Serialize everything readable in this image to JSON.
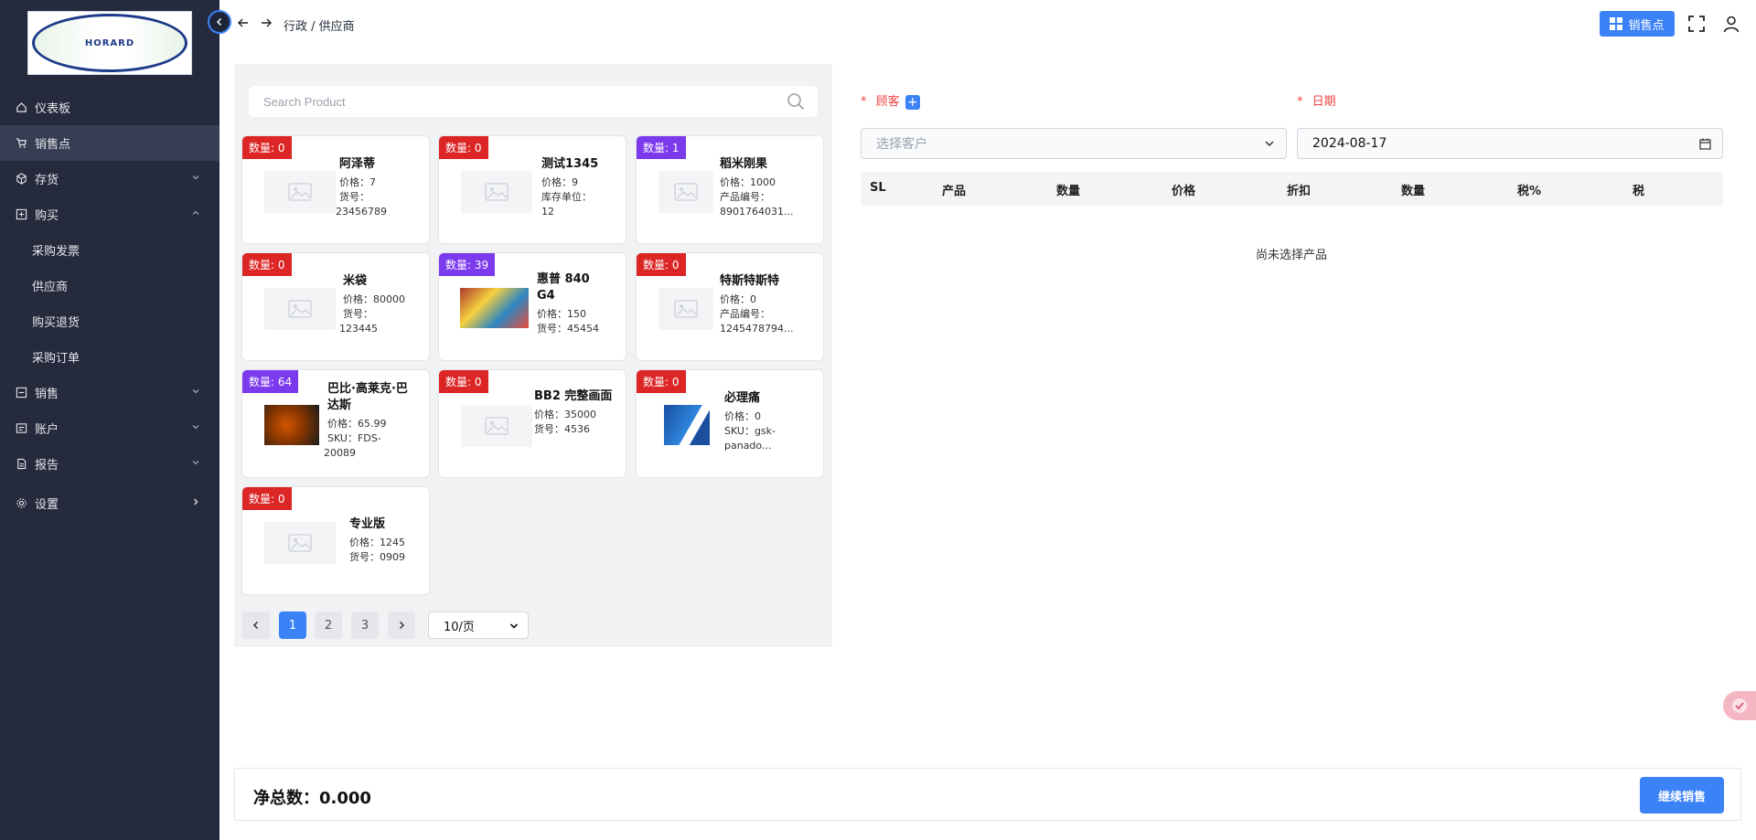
{
  "sidebar": {
    "logo_text": "HORARD",
    "items": [
      {
        "label": "仪表板",
        "icon": "home-icon"
      },
      {
        "label": "销售点",
        "icon": "cart-icon"
      },
      {
        "label": "存货",
        "icon": "box-icon"
      },
      {
        "label": "购买",
        "icon": "plus-square-icon"
      },
      {
        "label": "采购发票"
      },
      {
        "label": "供应商"
      },
      {
        "label": "购买退货"
      },
      {
        "label": "采购订单"
      },
      {
        "label": "销售",
        "icon": "minus-square-icon"
      },
      {
        "label": "账户",
        "icon": "account-icon"
      },
      {
        "label": "报告",
        "icon": "report-icon"
      },
      {
        "label": "设置",
        "icon": "gear-icon"
      }
    ]
  },
  "header": {
    "breadcrumb": "行政 / 供应商",
    "pos_button": "销售点"
  },
  "search": {
    "placeholder": "Search Product"
  },
  "products": [
    {
      "qty_label": "数量: 0",
      "name": "阿泽蒂",
      "line1": "价格：7",
      "line2": "货号：",
      "line3": "23456789"
    },
    {
      "qty_label": "数量: 0",
      "name": "测试1345",
      "line1": "价格：9",
      "line2": "库存单位：",
      "line3": "12"
    },
    {
      "qty_label": "数量: 1",
      "name": "稻米刚果",
      "line1": "价格：1000",
      "line2": "产品编号：",
      "line3": "8901764031..."
    },
    {
      "qty_label": "数量: 0",
      "name": "米袋",
      "line1": "价格：80000",
      "line2": "货号：",
      "line3": "123445"
    },
    {
      "qty_label": "数量: 39",
      "name": "惠普 840 G4",
      "line1": "价格：150",
      "line2": "货号：45454",
      "line3": ""
    },
    {
      "qty_label": "数量: 0",
      "name": "特斯特斯特",
      "line1": "价格：0",
      "line2": "产品编号：",
      "line3": "1245478794..."
    },
    {
      "qty_label": "数量: 64",
      "name": "巴比·高莱克·巴达斯",
      "line1": "价格：65.99",
      "line2": "SKU：FDS-",
      "line3": "20089"
    },
    {
      "qty_label": "数量: 0",
      "name": "BB2 完整画面",
      "line1": "价格：35000",
      "line2": "货号：4536",
      "line3": ""
    },
    {
      "qty_label": "数量: 0",
      "name": "必理痛",
      "line1": "价格：0",
      "line2": "SKU：gsk-",
      "line3": "panado..."
    },
    {
      "qty_label": "数量: 0",
      "name": "专业版",
      "line1": "价格：1245",
      "line2": "货号：0909",
      "line3": ""
    }
  ],
  "pagination": {
    "pages": [
      "1",
      "2",
      "3"
    ],
    "per_page": "10/页"
  },
  "form": {
    "customer_label": "顾客",
    "customer_placeholder": "选择客户",
    "date_label": "日期",
    "date_value": "2024-08-17",
    "required_mark": "*"
  },
  "table": {
    "headers": [
      "SL",
      "产品",
      "数量",
      "价格",
      "折扣",
      "数量",
      "税%",
      "税"
    ],
    "empty_text": "尚未选择产品"
  },
  "footer": {
    "net_total_label": "净总数：0.000",
    "continue_button": "继续销售"
  },
  "colors": {
    "sidebar_bg": "#252a3c",
    "accent": "#3b82f6",
    "badge_red": "#dc2626",
    "badge_purple": "#7c3aed"
  }
}
